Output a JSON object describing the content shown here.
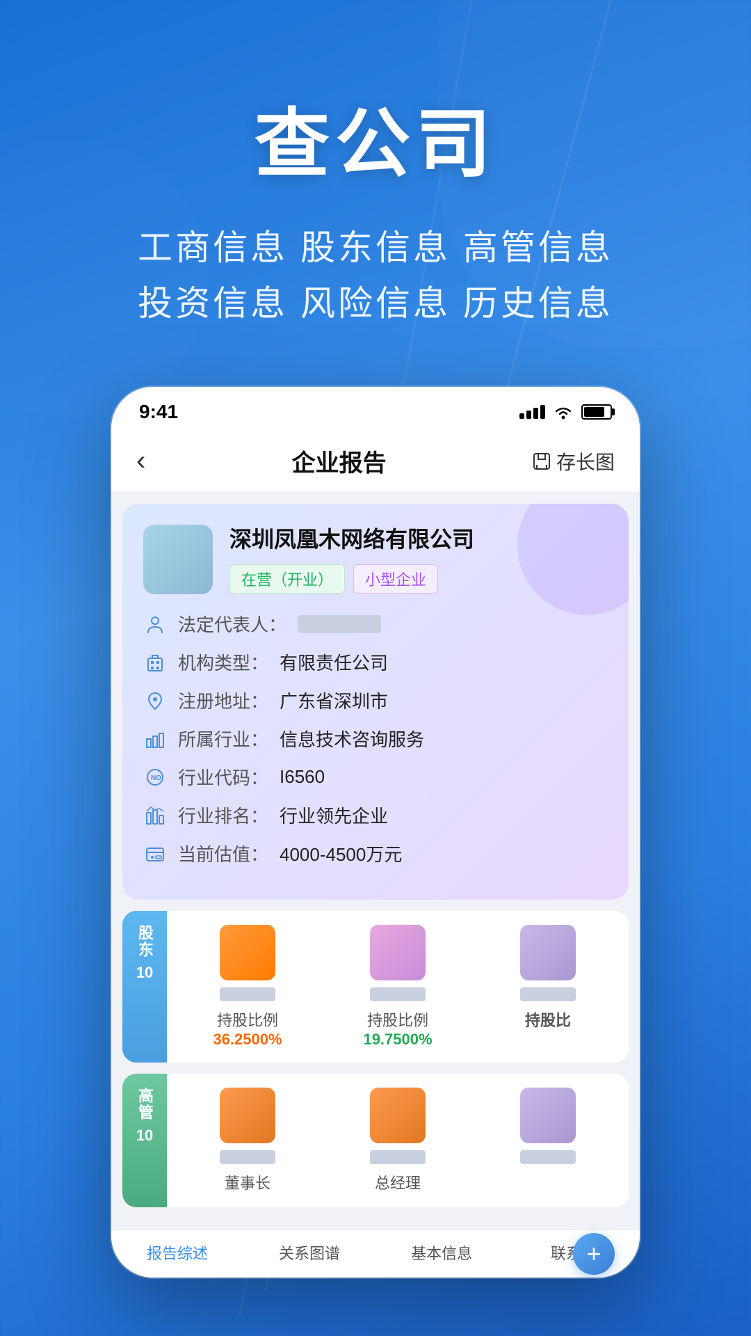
{
  "hero": {
    "title": "查公司",
    "subtitle_line1": "工商信息  股东信息  高管信息",
    "subtitle_line2": "投资信息  风险信息  历史信息"
  },
  "phone": {
    "status_bar": {
      "time": "9:41",
      "signal": "signal",
      "wifi": "wifi",
      "battery": "battery"
    },
    "nav": {
      "back_label": "‹",
      "title": "企业报告",
      "save_icon": "⬡",
      "save_label": "存长图"
    },
    "company": {
      "name": "深圳凤凰木网络有限公司",
      "badge_status": "在营（开业）",
      "badge_type": "小型企业",
      "legal_rep_label": "法定代表人：",
      "legal_rep_value": "[已模糊]",
      "org_type_label": "机构类型：",
      "org_type_value": "有限责任公司",
      "address_label": "注册地址：",
      "address_value": "广东省深圳市",
      "industry_label": "所属行业：",
      "industry_value": "信息技术咨询服务",
      "industry_code_label": "行业代码：",
      "industry_code_value": "I6560",
      "industry_rank_label": "行业排名：",
      "industry_rank_value": "行业领先企业",
      "valuation_label": "当前估值：",
      "valuation_value": "4000-4500万元"
    },
    "shareholders": {
      "section_label": "股东",
      "count": "10",
      "items": [
        {
          "name_blurred": true,
          "percent_label": "持股比例",
          "percent_value": "36.2500%",
          "percent_color": "orange",
          "avatar_color": "orange"
        },
        {
          "name_blurred": true,
          "percent_label": "持股比例",
          "percent_value": "19.7500%",
          "percent_color": "green",
          "avatar_color": "pink"
        },
        {
          "name_blurred": true,
          "percent_label": "持股比",
          "percent_value": "",
          "percent_color": "normal",
          "avatar_color": "light-purple"
        }
      ]
    },
    "executives": {
      "section_label": "高管",
      "count": "10",
      "items": [
        {
          "name_blurred": true,
          "title": "董事长",
          "avatar_color": "orange"
        },
        {
          "name_blurred": true,
          "title": "总经理",
          "avatar_color": "orange"
        },
        {
          "name_blurred": true,
          "title": "",
          "avatar_color": "light-purple"
        }
      ]
    },
    "tab_bar": {
      "tabs": [
        {
          "label": "报告综述",
          "active": true
        },
        {
          "label": "关系图谱",
          "active": false
        },
        {
          "label": "基本信息",
          "active": false
        },
        {
          "label": "联系信",
          "active": false
        }
      ],
      "fab_label": "+"
    }
  }
}
